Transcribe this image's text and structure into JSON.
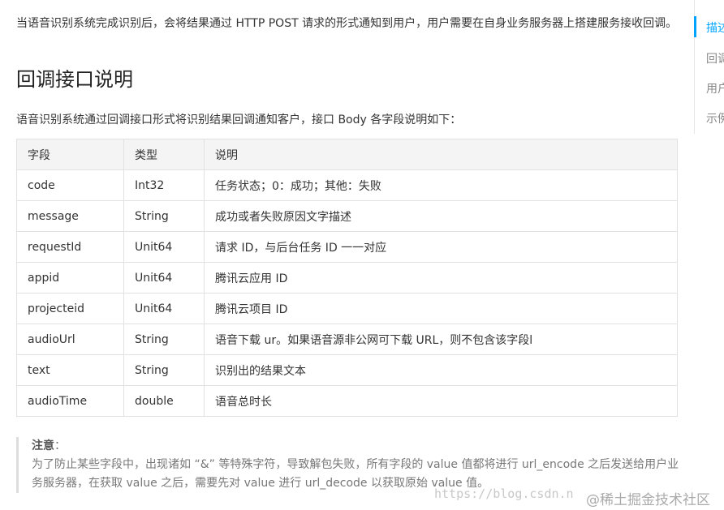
{
  "intro": "当语音识别系统完成识别后，会将结果通过 HTTP POST 请求的形式通知到用户，用户需要在自身业务服务器上搭建服务接收回调。",
  "section_title": "回调接口说明",
  "section_desc": "语音识别系统通过回调接口形式将识别结果回调通知客户，接口 Body 各字段说明如下：",
  "table": {
    "headers": [
      "字段",
      "类型",
      "说明"
    ],
    "rows": [
      [
        "code",
        "Int32",
        "任务状态；0：成功；其他：失败"
      ],
      [
        "message",
        "String",
        "成功或者失败原因文字描述"
      ],
      [
        "requestId",
        "Unit64",
        "请求 ID，与后台任务 ID 一一对应"
      ],
      [
        "appid",
        "Unit64",
        "腾讯云应用 ID"
      ],
      [
        "projecteid",
        "Unit64",
        "腾讯云项目 ID"
      ],
      [
        "audioUrl",
        "String",
        "语音下载 ur。如果语音源非公网可下载 URL，则不包含该字段l"
      ],
      [
        "text",
        "String",
        "识别出的结果文本"
      ],
      [
        "audioTime",
        "double",
        "语音总时长"
      ]
    ]
  },
  "note": {
    "title": "注意",
    "line1": "为了防止某些字段中，出现诸如 “&” 等特殊字符，导致解包失败，所有字段的 value 值都将进行 url_encode 之后发送给用户业",
    "line2": "务服务器，在获取 value 之后，需要先对 value 进行 url_decode 以获取原始 value 值。"
  },
  "toc": [
    "描述",
    "回调",
    "用户",
    "示例"
  ],
  "watermark": {
    "url": "https://blog.csdn.n",
    "logo": "@稀土掘金技术社区"
  },
  "colors": {
    "accent": "#00a4ff",
    "table_header_bg": "#f4f4f4",
    "border": "#e1e1e1"
  }
}
